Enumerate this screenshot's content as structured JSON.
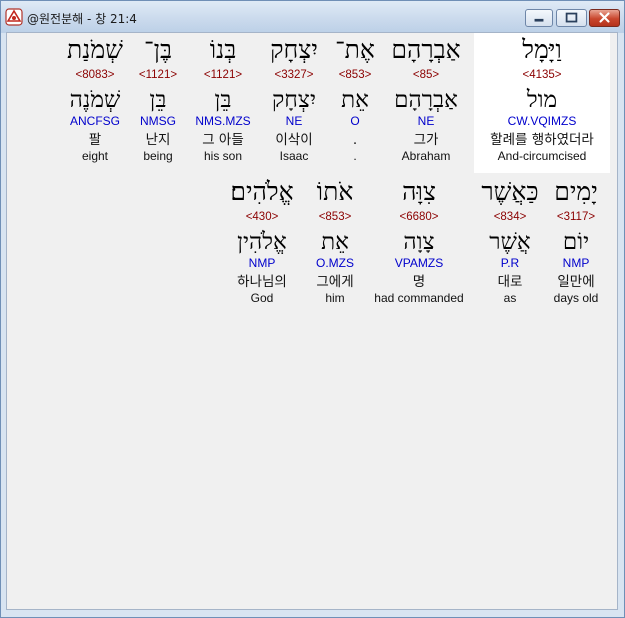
{
  "window": {
    "title": "@원전분해 - 창 21:4",
    "accent": "#c9462d"
  },
  "rows": [
    [
      {
        "hebrew": "וַיָּמָל",
        "strong": "<4135>",
        "lemma": "מול",
        "morph": "CW.VQIMZS",
        "korean": "할례를 행하였더라",
        "english": "And-circumcised",
        "highlight": true
      },
      {
        "hebrew": "אַבְרָהָם",
        "strong": "<85>",
        "lemma": "אַבְרָהָם",
        "morph": "NE",
        "korean": "그가",
        "english": "Abraham"
      },
      {
        "hebrew": "אֶת־",
        "strong": "<853>",
        "lemma": "אֵת",
        "morph": "O",
        "korean": ".",
        "english": "."
      },
      {
        "hebrew": "יִצְחָק",
        "strong": "<3327>",
        "lemma": "יִצְחָק",
        "morph": "NE",
        "korean": "이삭이",
        "english": "Isaac"
      },
      {
        "hebrew": "בְּנוֹ",
        "strong": "<1121>",
        "lemma": "בֵּן",
        "morph": "NMS.MZS",
        "korean": "그 아들",
        "english": "his son"
      },
      {
        "hebrew": "בֶּן־",
        "strong": "<1121>",
        "lemma": "בֵּן",
        "morph": "NMSG",
        "korean": "난지",
        "english": "being"
      },
      {
        "hebrew": "שְׁמֹנַת",
        "strong": "<8083>",
        "lemma": "שְׁמֹנֶה",
        "morph": "ANCFSG",
        "korean": "팔",
        "english": "eight"
      }
    ],
    [
      {
        "hebrew": "יָמִים",
        "strong": "<3117>",
        "lemma": "יוֹם",
        "morph": "NMP",
        "korean": "일만에",
        "english": "days old"
      },
      {
        "hebrew": "כַּאֲשֶׁר",
        "strong": "<834>",
        "lemma": "אֲשֶׁר",
        "morph": "P.R",
        "korean": "대로",
        "english": "as"
      },
      {
        "hebrew": "צִוָּה",
        "strong": "<6680>",
        "lemma": "צָוָה",
        "morph": "VPAMZS",
        "korean": "명",
        "english": "had commanded"
      },
      {
        "hebrew": "אֹתוֹ",
        "strong": "<853>",
        "lemma": "אֵת",
        "morph": "O.MZS",
        "korean": "그에게",
        "english": "him"
      },
      {
        "hebrew": "אֱלֹהִים׃",
        "strong": "<430>",
        "lemma": "אֱלֹהִין",
        "morph": "NMP",
        "korean": "하나님의",
        "english": "God"
      }
    ]
  ]
}
